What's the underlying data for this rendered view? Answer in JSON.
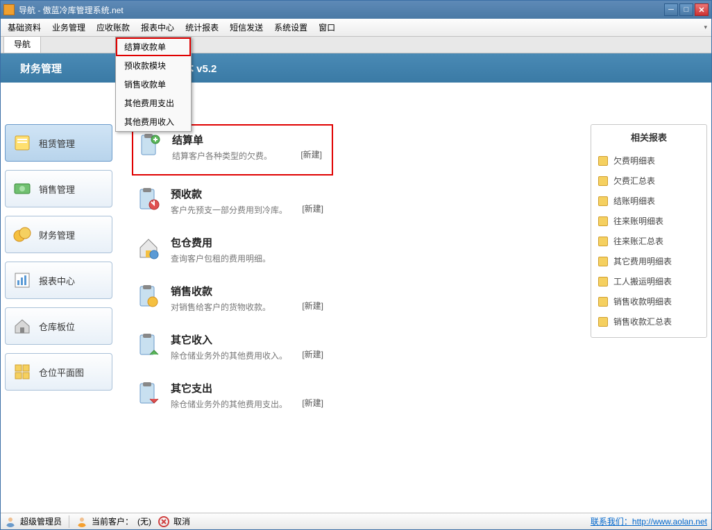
{
  "window": {
    "title": "导航 - 傲蓝冷库管理系统.net"
  },
  "menubar": [
    "基础资料",
    "业务管理",
    "应收账款",
    "报表中心",
    "统计报表",
    "短信发送",
    "系统设置",
    "窗口"
  ],
  "dropdown": [
    "结算收款单",
    "预收款模块",
    "销售收款单",
    "其他费用支出",
    "其他费用收入"
  ],
  "tab": "导航",
  "banner": {
    "left": "财务管理",
    "right": "软件试用版本 v5.2"
  },
  "sidebar": [
    {
      "label": "租赁管理"
    },
    {
      "label": "销售管理"
    },
    {
      "label": "财务管理"
    },
    {
      "label": "报表中心"
    },
    {
      "label": "仓库板位"
    },
    {
      "label": "仓位平面图"
    }
  ],
  "cards": [
    {
      "title": "结算单",
      "desc": "结算客户各种类型的欠费。",
      "new": "[新建]"
    },
    {
      "title": "预收款",
      "desc": "客户先预支一部分费用到冷库。",
      "new": "[新建]"
    },
    {
      "title": "包仓费用",
      "desc": "查询客户包租的费用明细。",
      "new": ""
    },
    {
      "title": "销售收款",
      "desc": "对销售给客户的货物收款。",
      "new": "[新建]"
    },
    {
      "title": "其它收入",
      "desc": "除仓储业务外的其他费用收入。",
      "new": "[新建]"
    },
    {
      "title": "其它支出",
      "desc": "除仓储业务外的其他费用支出。",
      "new": "[新建]"
    }
  ],
  "rightpanel": {
    "title": "相关报表",
    "links": [
      "欠费明细表",
      "欠费汇总表",
      "结账明细表",
      "往来账明细表",
      "往来账汇总表",
      "其它费用明细表",
      "工人搬运明细表",
      "销售收款明细表",
      "销售收款汇总表"
    ]
  },
  "status": {
    "user": "超级管理员",
    "cust_label": "当前客户：",
    "cust_val": "(无)",
    "cancel": "取消",
    "contact_label": "联系我们：",
    "contact_url": "http://www.aolan.net"
  }
}
